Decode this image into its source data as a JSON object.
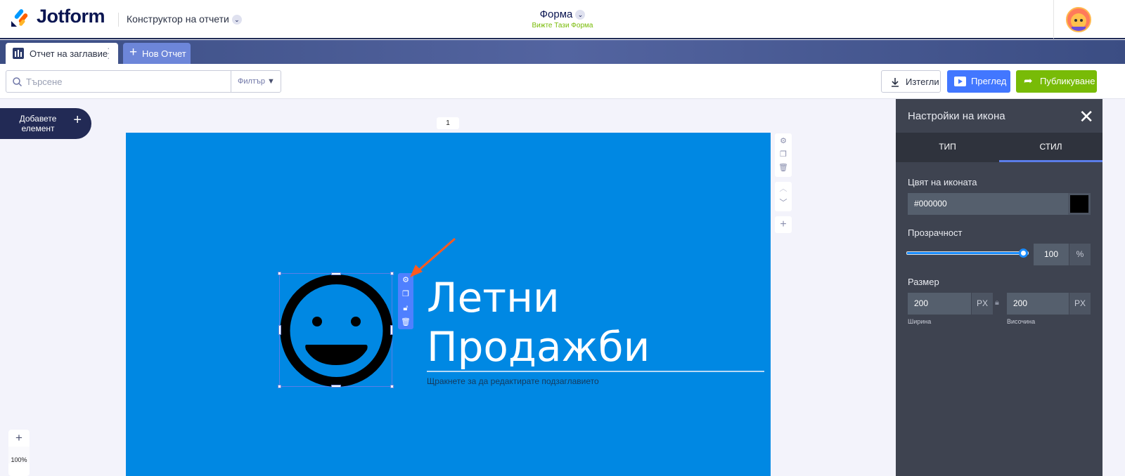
{
  "header": {
    "logo": "Jotform",
    "builder": "Конструктор на отчети",
    "form_title": "Форма",
    "form_link": "Вижте Тази Форма"
  },
  "tabs": {
    "active": "Отчет на заглавие",
    "new": "Нов Отчет"
  },
  "toolbar": {
    "search_placeholder": "Търсене",
    "filter": "Филтър",
    "download": "Изтегли",
    "preview": "Преглед",
    "publish": "Публикуване"
  },
  "canvas": {
    "add_element": "Добавете елемент",
    "page_number": "1",
    "title_line1": "Летни",
    "title_line2": "Продажби",
    "subtitle": "Щракнете за да редактирате подзаглавието",
    "zoom": "100%",
    "page_color": "#0088e3"
  },
  "panel": {
    "title": "Настройки на икона",
    "tabs": [
      "ТИП",
      "СТИЛ"
    ],
    "active_tab": "СТИЛ",
    "color_label": "Цвят на иконата",
    "color_value": "#000000",
    "opacity_label": "Прозрачност",
    "opacity_value": "100",
    "opacity_unit": "%",
    "opacity_fraction": 1.0,
    "size_label": "Размер",
    "width_value": "200",
    "height_value": "200",
    "unit": "PX",
    "width_label": "Ширина",
    "height_label": "Височина"
  }
}
